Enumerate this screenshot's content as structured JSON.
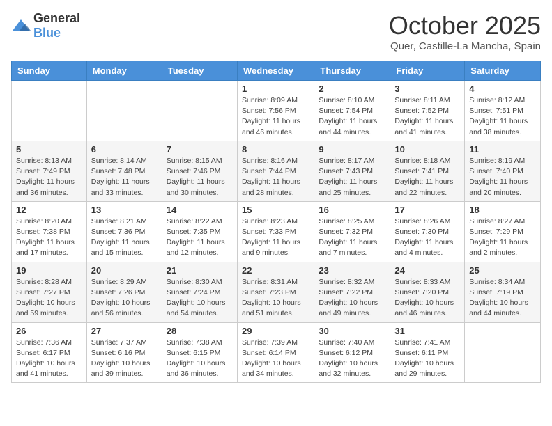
{
  "header": {
    "logo_general": "General",
    "logo_blue": "Blue",
    "month_title": "October 2025",
    "location": "Quer, Castille-La Mancha, Spain"
  },
  "weekdays": [
    "Sunday",
    "Monday",
    "Tuesday",
    "Wednesday",
    "Thursday",
    "Friday",
    "Saturday"
  ],
  "weeks": [
    [
      {
        "day": "",
        "info": ""
      },
      {
        "day": "",
        "info": ""
      },
      {
        "day": "",
        "info": ""
      },
      {
        "day": "1",
        "info": "Sunrise: 8:09 AM\nSunset: 7:56 PM\nDaylight: 11 hours and 46 minutes."
      },
      {
        "day": "2",
        "info": "Sunrise: 8:10 AM\nSunset: 7:54 PM\nDaylight: 11 hours and 44 minutes."
      },
      {
        "day": "3",
        "info": "Sunrise: 8:11 AM\nSunset: 7:52 PM\nDaylight: 11 hours and 41 minutes."
      },
      {
        "day": "4",
        "info": "Sunrise: 8:12 AM\nSunset: 7:51 PM\nDaylight: 11 hours and 38 minutes."
      }
    ],
    [
      {
        "day": "5",
        "info": "Sunrise: 8:13 AM\nSunset: 7:49 PM\nDaylight: 11 hours and 36 minutes."
      },
      {
        "day": "6",
        "info": "Sunrise: 8:14 AM\nSunset: 7:48 PM\nDaylight: 11 hours and 33 minutes."
      },
      {
        "day": "7",
        "info": "Sunrise: 8:15 AM\nSunset: 7:46 PM\nDaylight: 11 hours and 30 minutes."
      },
      {
        "day": "8",
        "info": "Sunrise: 8:16 AM\nSunset: 7:44 PM\nDaylight: 11 hours and 28 minutes."
      },
      {
        "day": "9",
        "info": "Sunrise: 8:17 AM\nSunset: 7:43 PM\nDaylight: 11 hours and 25 minutes."
      },
      {
        "day": "10",
        "info": "Sunrise: 8:18 AM\nSunset: 7:41 PM\nDaylight: 11 hours and 22 minutes."
      },
      {
        "day": "11",
        "info": "Sunrise: 8:19 AM\nSunset: 7:40 PM\nDaylight: 11 hours and 20 minutes."
      }
    ],
    [
      {
        "day": "12",
        "info": "Sunrise: 8:20 AM\nSunset: 7:38 PM\nDaylight: 11 hours and 17 minutes."
      },
      {
        "day": "13",
        "info": "Sunrise: 8:21 AM\nSunset: 7:36 PM\nDaylight: 11 hours and 15 minutes."
      },
      {
        "day": "14",
        "info": "Sunrise: 8:22 AM\nSunset: 7:35 PM\nDaylight: 11 hours and 12 minutes."
      },
      {
        "day": "15",
        "info": "Sunrise: 8:23 AM\nSunset: 7:33 PM\nDaylight: 11 hours and 9 minutes."
      },
      {
        "day": "16",
        "info": "Sunrise: 8:25 AM\nSunset: 7:32 PM\nDaylight: 11 hours and 7 minutes."
      },
      {
        "day": "17",
        "info": "Sunrise: 8:26 AM\nSunset: 7:30 PM\nDaylight: 11 hours and 4 minutes."
      },
      {
        "day": "18",
        "info": "Sunrise: 8:27 AM\nSunset: 7:29 PM\nDaylight: 11 hours and 2 minutes."
      }
    ],
    [
      {
        "day": "19",
        "info": "Sunrise: 8:28 AM\nSunset: 7:27 PM\nDaylight: 10 hours and 59 minutes."
      },
      {
        "day": "20",
        "info": "Sunrise: 8:29 AM\nSunset: 7:26 PM\nDaylight: 10 hours and 56 minutes."
      },
      {
        "day": "21",
        "info": "Sunrise: 8:30 AM\nSunset: 7:24 PM\nDaylight: 10 hours and 54 minutes."
      },
      {
        "day": "22",
        "info": "Sunrise: 8:31 AM\nSunset: 7:23 PM\nDaylight: 10 hours and 51 minutes."
      },
      {
        "day": "23",
        "info": "Sunrise: 8:32 AM\nSunset: 7:22 PM\nDaylight: 10 hours and 49 minutes."
      },
      {
        "day": "24",
        "info": "Sunrise: 8:33 AM\nSunset: 7:20 PM\nDaylight: 10 hours and 46 minutes."
      },
      {
        "day": "25",
        "info": "Sunrise: 8:34 AM\nSunset: 7:19 PM\nDaylight: 10 hours and 44 minutes."
      }
    ],
    [
      {
        "day": "26",
        "info": "Sunrise: 7:36 AM\nSunset: 6:17 PM\nDaylight: 10 hours and 41 minutes."
      },
      {
        "day": "27",
        "info": "Sunrise: 7:37 AM\nSunset: 6:16 PM\nDaylight: 10 hours and 39 minutes."
      },
      {
        "day": "28",
        "info": "Sunrise: 7:38 AM\nSunset: 6:15 PM\nDaylight: 10 hours and 36 minutes."
      },
      {
        "day": "29",
        "info": "Sunrise: 7:39 AM\nSunset: 6:14 PM\nDaylight: 10 hours and 34 minutes."
      },
      {
        "day": "30",
        "info": "Sunrise: 7:40 AM\nSunset: 6:12 PM\nDaylight: 10 hours and 32 minutes."
      },
      {
        "day": "31",
        "info": "Sunrise: 7:41 AM\nSunset: 6:11 PM\nDaylight: 10 hours and 29 minutes."
      },
      {
        "day": "",
        "info": ""
      }
    ]
  ]
}
